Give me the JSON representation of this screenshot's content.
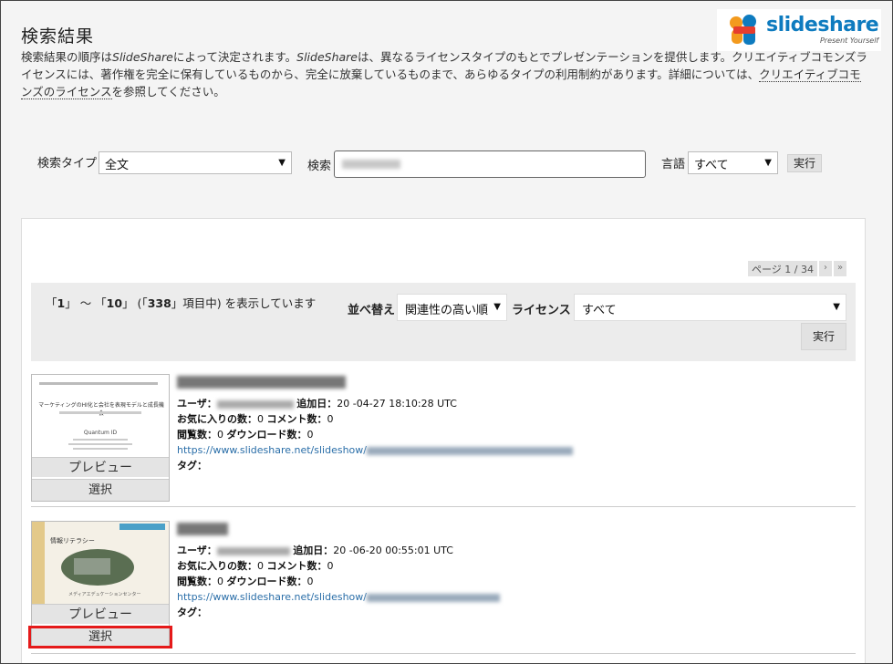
{
  "header": {
    "title": "検索結果",
    "desc_part1": "検索結果の順序は",
    "desc_em1": "SlideShare",
    "desc_part2": "によって決定されます。",
    "desc_em2": "SlideShare",
    "desc_part3": "は、異なるライセンスタイプのもとでプレゼンテーションを提供します。クリエイティブコモンズライセンスには、著作権を完全に保有しているものから、完全に放棄しているものまで、あらゆるタイプの利用制約があります。詳細については、",
    "desc_link": "クリエイティブコモンズのライセンス",
    "desc_part4": "を参照してください。"
  },
  "logo": {
    "word_slide": "slide",
    "word_share": "share",
    "tagline": "Present Yourself"
  },
  "search": {
    "type_label": "検索タイプ",
    "type_value": "全文",
    "query_label": "検索",
    "lang_label": "言語",
    "lang_value": "すべて",
    "run_label": "実行"
  },
  "pager": {
    "page_text": "ページ 1 / 34",
    "next": "›",
    "last": "»"
  },
  "results_bar": {
    "count_open": "「",
    "count_from": "1",
    "count_mid": "」 ～ 「",
    "count_to": "10",
    "count_mid2": "」 (「",
    "count_total": "338",
    "count_end": "」項目中) を表示しています",
    "sort_label": "並べ替え",
    "sort_value": "関連性の高い順",
    "license_label": "ライセンス",
    "license_value": "すべて",
    "run_label": "実行"
  },
  "items": [
    {
      "user_label": "ユーザ：",
      "date_label": "追加日：",
      "date_value": "20  -04-27 18:10:28 UTC",
      "fav_label": "お気に入りの数：",
      "fav_value": "0",
      "comment_label": "コメント数：",
      "comment_value": "0",
      "view_label": "閲覧数：",
      "view_value": "0",
      "dl_label": "ダウンロード数：",
      "dl_value": "0",
      "url": "https://www.slideshare.net/slideshow/",
      "tag_label": "タグ：",
      "preview": "プレビュー",
      "select": "選択",
      "slide_title": "マーケティングのHI化と会社を表現モデルと成長機会",
      "slide_sub": "Quantum ID"
    },
    {
      "user_label": "ユーザ：",
      "date_label": "追加日：",
      "date_value": "20  -06-20 00:55:01 UTC",
      "fav_label": "お気に入りの数：",
      "fav_value": "0",
      "comment_label": "コメント数：",
      "comment_value": "0",
      "view_label": "閲覧数：",
      "view_value": "0",
      "dl_label": "ダウンロード数：",
      "dl_value": "0",
      "url": "https://www.slideshare.net/slideshow/",
      "tag_label": "タグ：",
      "preview": "プレビュー",
      "select": "選択",
      "slide_title": "情報リテラシー",
      "slide_sub": "メディアエデュケーションセンター"
    }
  ],
  "colors": {
    "accent_link": "#2a6ea8",
    "brand_blue": "#0e7bbf",
    "brand_orange": "#f39a1d",
    "highlight": "#e51a1a"
  }
}
